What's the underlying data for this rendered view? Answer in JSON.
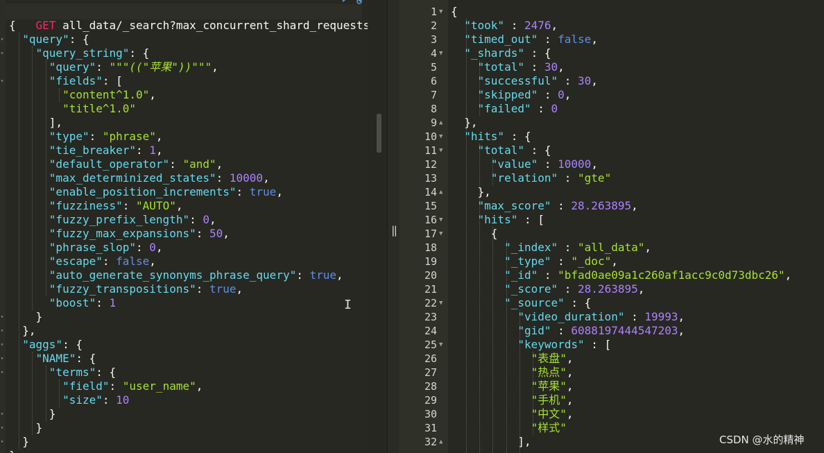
{
  "request": {
    "method": "GET",
    "path": "all_data/_search?max_concurrent_shard_requests=30"
  },
  "watermark": "CSDN @水的精神",
  "left_editor": {
    "lines": [
      [
        [
          "p",
          "{"
        ]
      ],
      [
        [
          "p",
          "  "
        ],
        [
          "k",
          "\"query\""
        ],
        [
          "p",
          ": {"
        ]
      ],
      [
        [
          "p",
          "    "
        ],
        [
          "k",
          "\"query_string\""
        ],
        [
          "p",
          ": {"
        ]
      ],
      [
        [
          "p",
          "      "
        ],
        [
          "k",
          "\"query\""
        ],
        [
          "p",
          ": "
        ],
        [
          "s",
          "\"\"\""
        ],
        [
          "s i",
          "((\"苹果\"))"
        ],
        [
          "s",
          "\"\"\""
        ],
        [
          "p",
          ","
        ]
      ],
      [
        [
          "p",
          "      "
        ],
        [
          "k",
          "\"fields\""
        ],
        [
          "p",
          ": ["
        ]
      ],
      [
        [
          "p",
          "        "
        ],
        [
          "s",
          "\"content^1.0\""
        ],
        [
          "p",
          ","
        ]
      ],
      [
        [
          "p",
          "        "
        ],
        [
          "s",
          "\"title^1.0\""
        ]
      ],
      [
        [
          "p",
          "      ],"
        ]
      ],
      [
        [
          "p",
          "      "
        ],
        [
          "k",
          "\"type\""
        ],
        [
          "p",
          ": "
        ],
        [
          "s",
          "\"phrase\""
        ],
        [
          "p",
          ","
        ]
      ],
      [
        [
          "p",
          "      "
        ],
        [
          "k",
          "\"tie_breaker\""
        ],
        [
          "p",
          ": "
        ],
        [
          "n",
          "1"
        ],
        [
          "p",
          ","
        ]
      ],
      [
        [
          "p",
          "      "
        ],
        [
          "k",
          "\"default_operator\""
        ],
        [
          "p",
          ": "
        ],
        [
          "s",
          "\"and\""
        ],
        [
          "p",
          ","
        ]
      ],
      [
        [
          "p",
          "      "
        ],
        [
          "k",
          "\"max_determinized_states\""
        ],
        [
          "p",
          ": "
        ],
        [
          "n",
          "10000"
        ],
        [
          "p",
          ","
        ]
      ],
      [
        [
          "p",
          "      "
        ],
        [
          "k",
          "\"enable_position_increments\""
        ],
        [
          "p",
          ": "
        ],
        [
          "b",
          "true"
        ],
        [
          "p",
          ","
        ]
      ],
      [
        [
          "p",
          "      "
        ],
        [
          "k",
          "\"fuzziness\""
        ],
        [
          "p",
          ": "
        ],
        [
          "s",
          "\"AUTO\""
        ],
        [
          "p",
          ","
        ]
      ],
      [
        [
          "p",
          "      "
        ],
        [
          "k",
          "\"fuzzy_prefix_length\""
        ],
        [
          "p",
          ": "
        ],
        [
          "n",
          "0"
        ],
        [
          "p",
          ","
        ]
      ],
      [
        [
          "p",
          "      "
        ],
        [
          "k",
          "\"fuzzy_max_expansions\""
        ],
        [
          "p",
          ": "
        ],
        [
          "n",
          "50"
        ],
        [
          "p",
          ","
        ]
      ],
      [
        [
          "p",
          "      "
        ],
        [
          "k",
          "\"phrase_slop\""
        ],
        [
          "p",
          ": "
        ],
        [
          "n",
          "0"
        ],
        [
          "p",
          ","
        ]
      ],
      [
        [
          "p",
          "      "
        ],
        [
          "k",
          "\"escape\""
        ],
        [
          "p",
          ": "
        ],
        [
          "b",
          "false"
        ],
        [
          "p",
          ","
        ]
      ],
      [
        [
          "p",
          "      "
        ],
        [
          "k",
          "\"auto_generate_synonyms_phrase_query\""
        ],
        [
          "p",
          ": "
        ],
        [
          "b",
          "true"
        ],
        [
          "p",
          ","
        ]
      ],
      [
        [
          "p",
          "      "
        ],
        [
          "k",
          "\"fuzzy_transpositions\""
        ],
        [
          "p",
          ": "
        ],
        [
          "b",
          "true"
        ],
        [
          "p",
          ","
        ]
      ],
      [
        [
          "p",
          "      "
        ],
        [
          "k",
          "\"boost\""
        ],
        [
          "p",
          ": "
        ],
        [
          "n",
          "1"
        ]
      ],
      [
        [
          "p",
          "    }"
        ]
      ],
      [
        [
          "p",
          "  },"
        ]
      ],
      [
        [
          "p",
          "  "
        ],
        [
          "k",
          "\"aggs\""
        ],
        [
          "p",
          ": {"
        ]
      ],
      [
        [
          "p",
          "    "
        ],
        [
          "k",
          "\"NAME\""
        ],
        [
          "p",
          ": {"
        ]
      ],
      [
        [
          "p",
          "      "
        ],
        [
          "k",
          "\"terms\""
        ],
        [
          "p",
          ": {"
        ]
      ],
      [
        [
          "p",
          "        "
        ],
        [
          "k",
          "\"field\""
        ],
        [
          "p",
          ": "
        ],
        [
          "s",
          "\"user_name\""
        ],
        [
          "p",
          ","
        ]
      ],
      [
        [
          "p",
          "        "
        ],
        [
          "k",
          "\"size\""
        ],
        [
          "p",
          ": "
        ],
        [
          "n",
          "10"
        ]
      ],
      [
        [
          "p",
          "      }"
        ]
      ],
      [
        [
          "p",
          "    }"
        ]
      ],
      [
        [
          "p",
          "  }"
        ]
      ],
      [
        [
          "p",
          "}"
        ]
      ]
    ]
  },
  "right_editor": {
    "lines": [
      {
        "n": "1",
        "f": "down",
        "t": [
          [
            "p",
            "{"
          ]
        ]
      },
      {
        "n": "2",
        "t": [
          [
            "p",
            "  "
          ],
          [
            "k",
            "\"took\""
          ],
          [
            "p",
            " : "
          ],
          [
            "n",
            "2476"
          ],
          [
            "p",
            ","
          ]
        ]
      },
      {
        "n": "3",
        "t": [
          [
            "p",
            "  "
          ],
          [
            "k",
            "\"timed_out\""
          ],
          [
            "p",
            " : "
          ],
          [
            "b",
            "false"
          ],
          [
            "p",
            ","
          ]
        ]
      },
      {
        "n": "4",
        "f": "down",
        "t": [
          [
            "p",
            "  "
          ],
          [
            "k",
            "\"_shards\""
          ],
          [
            "p",
            " : {"
          ]
        ]
      },
      {
        "n": "5",
        "t": [
          [
            "p",
            "    "
          ],
          [
            "k",
            "\"total\""
          ],
          [
            "p",
            " : "
          ],
          [
            "n",
            "30"
          ],
          [
            "p",
            ","
          ]
        ]
      },
      {
        "n": "6",
        "t": [
          [
            "p",
            "    "
          ],
          [
            "k",
            "\"successful\""
          ],
          [
            "p",
            " : "
          ],
          [
            "n",
            "30"
          ],
          [
            "p",
            ","
          ]
        ]
      },
      {
        "n": "7",
        "t": [
          [
            "p",
            "    "
          ],
          [
            "k",
            "\"skipped\""
          ],
          [
            "p",
            " : "
          ],
          [
            "n",
            "0"
          ],
          [
            "p",
            ","
          ]
        ]
      },
      {
        "n": "8",
        "t": [
          [
            "p",
            "    "
          ],
          [
            "k",
            "\"failed\""
          ],
          [
            "p",
            " : "
          ],
          [
            "n",
            "0"
          ]
        ]
      },
      {
        "n": "9",
        "f": "up",
        "t": [
          [
            "p",
            "  },"
          ]
        ]
      },
      {
        "n": "10",
        "f": "down",
        "t": [
          [
            "p",
            "  "
          ],
          [
            "k",
            "\"hits\""
          ],
          [
            "p",
            " : {"
          ]
        ]
      },
      {
        "n": "11",
        "f": "down",
        "t": [
          [
            "p",
            "    "
          ],
          [
            "k",
            "\"total\""
          ],
          [
            "p",
            " : {"
          ]
        ]
      },
      {
        "n": "12",
        "t": [
          [
            "p",
            "      "
          ],
          [
            "k",
            "\"value\""
          ],
          [
            "p",
            " : "
          ],
          [
            "n",
            "10000"
          ],
          [
            "p",
            ","
          ]
        ]
      },
      {
        "n": "13",
        "t": [
          [
            "p",
            "      "
          ],
          [
            "k",
            "\"relation\""
          ],
          [
            "p",
            " : "
          ],
          [
            "s",
            "\"gte\""
          ]
        ]
      },
      {
        "n": "14",
        "f": "up",
        "t": [
          [
            "p",
            "    },"
          ]
        ]
      },
      {
        "n": "15",
        "t": [
          [
            "p",
            "    "
          ],
          [
            "k",
            "\"max_score\""
          ],
          [
            "p",
            " : "
          ],
          [
            "n",
            "28.263895"
          ],
          [
            "p",
            ","
          ]
        ]
      },
      {
        "n": "16",
        "f": "down",
        "t": [
          [
            "p",
            "    "
          ],
          [
            "k",
            "\"hits\""
          ],
          [
            "p",
            " : ["
          ]
        ]
      },
      {
        "n": "17",
        "f": "down",
        "t": [
          [
            "p",
            "      {"
          ]
        ]
      },
      {
        "n": "18",
        "t": [
          [
            "p",
            "        "
          ],
          [
            "k",
            "\"_index\""
          ],
          [
            "p",
            " : "
          ],
          [
            "s",
            "\"all_data\""
          ],
          [
            "p",
            ","
          ]
        ]
      },
      {
        "n": "19",
        "t": [
          [
            "p",
            "        "
          ],
          [
            "k",
            "\"_type\""
          ],
          [
            "p",
            " : "
          ],
          [
            "s",
            "\"_doc\""
          ],
          [
            "p",
            ","
          ]
        ]
      },
      {
        "n": "20",
        "t": [
          [
            "p",
            "        "
          ],
          [
            "k",
            "\"_id\""
          ],
          [
            "p",
            " : "
          ],
          [
            "s",
            "\"bfad0ae09a1c260af1acc9c0d73dbc26\""
          ],
          [
            "p",
            ","
          ]
        ]
      },
      {
        "n": "21",
        "t": [
          [
            "p",
            "        "
          ],
          [
            "k",
            "\"_score\""
          ],
          [
            "p",
            " : "
          ],
          [
            "n",
            "28.263895"
          ],
          [
            "p",
            ","
          ]
        ]
      },
      {
        "n": "22",
        "f": "down",
        "t": [
          [
            "p",
            "        "
          ],
          [
            "k",
            "\"_source\""
          ],
          [
            "p",
            " : {"
          ]
        ]
      },
      {
        "n": "23",
        "t": [
          [
            "p",
            "          "
          ],
          [
            "k",
            "\"video_duration\""
          ],
          [
            "p",
            " : "
          ],
          [
            "n",
            "19993"
          ],
          [
            "p",
            ","
          ]
        ]
      },
      {
        "n": "24",
        "t": [
          [
            "p",
            "          "
          ],
          [
            "k",
            "\"gid\""
          ],
          [
            "p",
            " : "
          ],
          [
            "n",
            "6088197444547203"
          ],
          [
            "p",
            ","
          ]
        ]
      },
      {
        "n": "25",
        "f": "down",
        "t": [
          [
            "p",
            "          "
          ],
          [
            "k",
            "\"keywords\""
          ],
          [
            "p",
            " : ["
          ]
        ]
      },
      {
        "n": "26",
        "t": [
          [
            "p",
            "            "
          ],
          [
            "s",
            "\"表盘\""
          ],
          [
            "p",
            ","
          ]
        ]
      },
      {
        "n": "27",
        "t": [
          [
            "p",
            "            "
          ],
          [
            "s",
            "\"热点\""
          ],
          [
            "p",
            ","
          ]
        ]
      },
      {
        "n": "28",
        "t": [
          [
            "p",
            "            "
          ],
          [
            "s",
            "\"苹果\""
          ],
          [
            "p",
            ","
          ]
        ]
      },
      {
        "n": "29",
        "t": [
          [
            "p",
            "            "
          ],
          [
            "s",
            "\"手机\""
          ],
          [
            "p",
            ","
          ]
        ]
      },
      {
        "n": "30",
        "t": [
          [
            "p",
            "            "
          ],
          [
            "s",
            "\"中文\""
          ],
          [
            "p",
            ","
          ]
        ]
      },
      {
        "n": "31",
        "t": [
          [
            "p",
            "            "
          ],
          [
            "s",
            "\"样式\""
          ]
        ]
      },
      {
        "n": "32",
        "f": "up",
        "t": [
          [
            "p",
            "          ],"
          ]
        ]
      }
    ]
  }
}
